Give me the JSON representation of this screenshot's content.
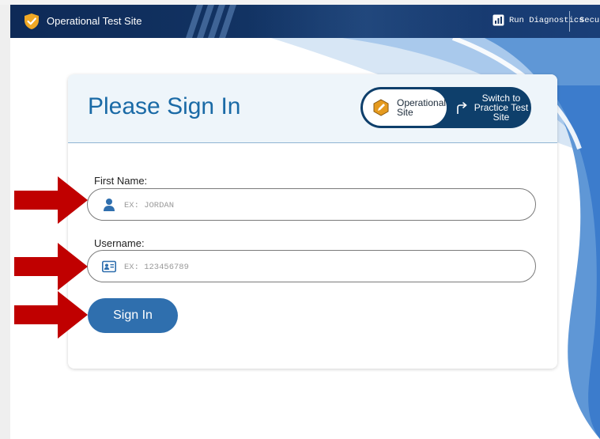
{
  "header": {
    "site_title": "Operational Test Site",
    "run_diagnostics_label": "Run Diagnostics",
    "secure_label": "Secure"
  },
  "card": {
    "title": "Please Sign In",
    "site_toggle": {
      "operational_label": "Operational Site",
      "practice_label": "Switch to Practice Test Site"
    }
  },
  "form": {
    "first_name": {
      "label": "First Name:",
      "placeholder": "EX: JORDAN",
      "value": ""
    },
    "username": {
      "label": "Username:",
      "placeholder": "EX: 123456789",
      "value": ""
    },
    "sign_in_label": "Sign In"
  },
  "icons": {
    "brand": "shield-check-icon",
    "diagnostics": "diagnostics-icon",
    "operational": "pencil-hexagon-icon",
    "practice": "redo-arrow-icon",
    "first_name": "person-icon",
    "username": "id-card-icon",
    "annotation": "red-arrow-icon"
  },
  "colors": {
    "topbar": "#123363",
    "title": "#1a6aa6",
    "button": "#2f6fae",
    "toggle_dark": "#0e3f6b",
    "badge": "#e59a1e",
    "annotation_arrow": "#c00000"
  }
}
